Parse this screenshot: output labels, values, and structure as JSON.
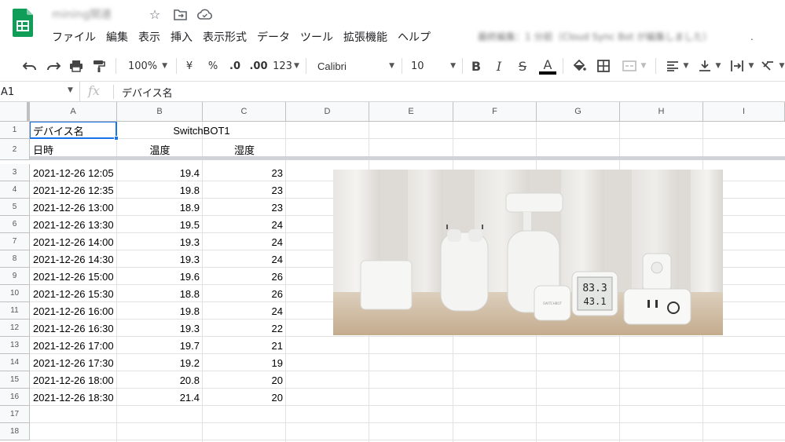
{
  "app": {
    "doc_title": "mining関連",
    "menu": [
      "ファイル",
      "編集",
      "表示",
      "挿入",
      "表示形式",
      "データ",
      "ツール",
      "拡張機能",
      "ヘルプ"
    ],
    "last_edit": "最終編集：1 分前（Cloud Sync Bot が編集しました）",
    "last_edit_suffix": "."
  },
  "toolbar": {
    "zoom": "100%",
    "currency": "¥",
    "percent": "%",
    "decrease_decimal": ".0",
    "increase_decimal": ".00",
    "more_formats": "123",
    "font": "Calibri",
    "font_size": "10",
    "bold": "B",
    "italic": "I",
    "strike": "S",
    "text_color": "A",
    "text_color_hex": "#000000"
  },
  "formula_bar": {
    "cell_ref": "A1",
    "fx": "fx",
    "value": "デバイス名"
  },
  "columns": [
    "A",
    "B",
    "C",
    "D",
    "E",
    "F",
    "G",
    "H",
    "I"
  ],
  "rows": [
    "1",
    "2",
    "3",
    "4",
    "5",
    "6",
    "7",
    "8",
    "9",
    "10",
    "11",
    "12",
    "13",
    "14",
    "15",
    "16",
    "17",
    "18"
  ],
  "sheet": {
    "a1": "デバイス名",
    "b1": "SwitchBOT1",
    "a2": "日時",
    "b2": "温度",
    "c2": "湿度",
    "data": [
      {
        "time": "2021-12-26 12:05",
        "temp": "19.4",
        "hum": "23"
      },
      {
        "time": "2021-12-26 12:35",
        "temp": "19.8",
        "hum": "23"
      },
      {
        "time": "2021-12-26 13:00",
        "temp": "18.9",
        "hum": "23"
      },
      {
        "time": "2021-12-26 13:30",
        "temp": "19.5",
        "hum": "24"
      },
      {
        "time": "2021-12-26 14:00",
        "temp": "19.3",
        "hum": "24"
      },
      {
        "time": "2021-12-26 14:30",
        "temp": "19.3",
        "hum": "24"
      },
      {
        "time": "2021-12-26 15:00",
        "temp": "19.6",
        "hum": "26"
      },
      {
        "time": "2021-12-26 15:30",
        "temp": "18.8",
        "hum": "26"
      },
      {
        "time": "2021-12-26 16:00",
        "temp": "19.8",
        "hum": "24"
      },
      {
        "time": "2021-12-26 16:30",
        "temp": "19.3",
        "hum": "22"
      },
      {
        "time": "2021-12-26 17:00",
        "temp": "19.7",
        "hum": "21"
      },
      {
        "time": "2021-12-26 17:30",
        "temp": "19.2",
        "hum": "19"
      },
      {
        "time": "2021-12-26 18:00",
        "temp": "20.8",
        "hum": "20"
      },
      {
        "time": "2021-12-26 18:30",
        "temp": "21.4",
        "hum": "20"
      }
    ]
  },
  "product_image": {
    "brand": "SWITCHBOT",
    "meter_humidity": "83.3",
    "meter_temp": "43.1"
  },
  "colors": {
    "accent": "#1a73e8",
    "sheets_green": "#0f9d58"
  }
}
